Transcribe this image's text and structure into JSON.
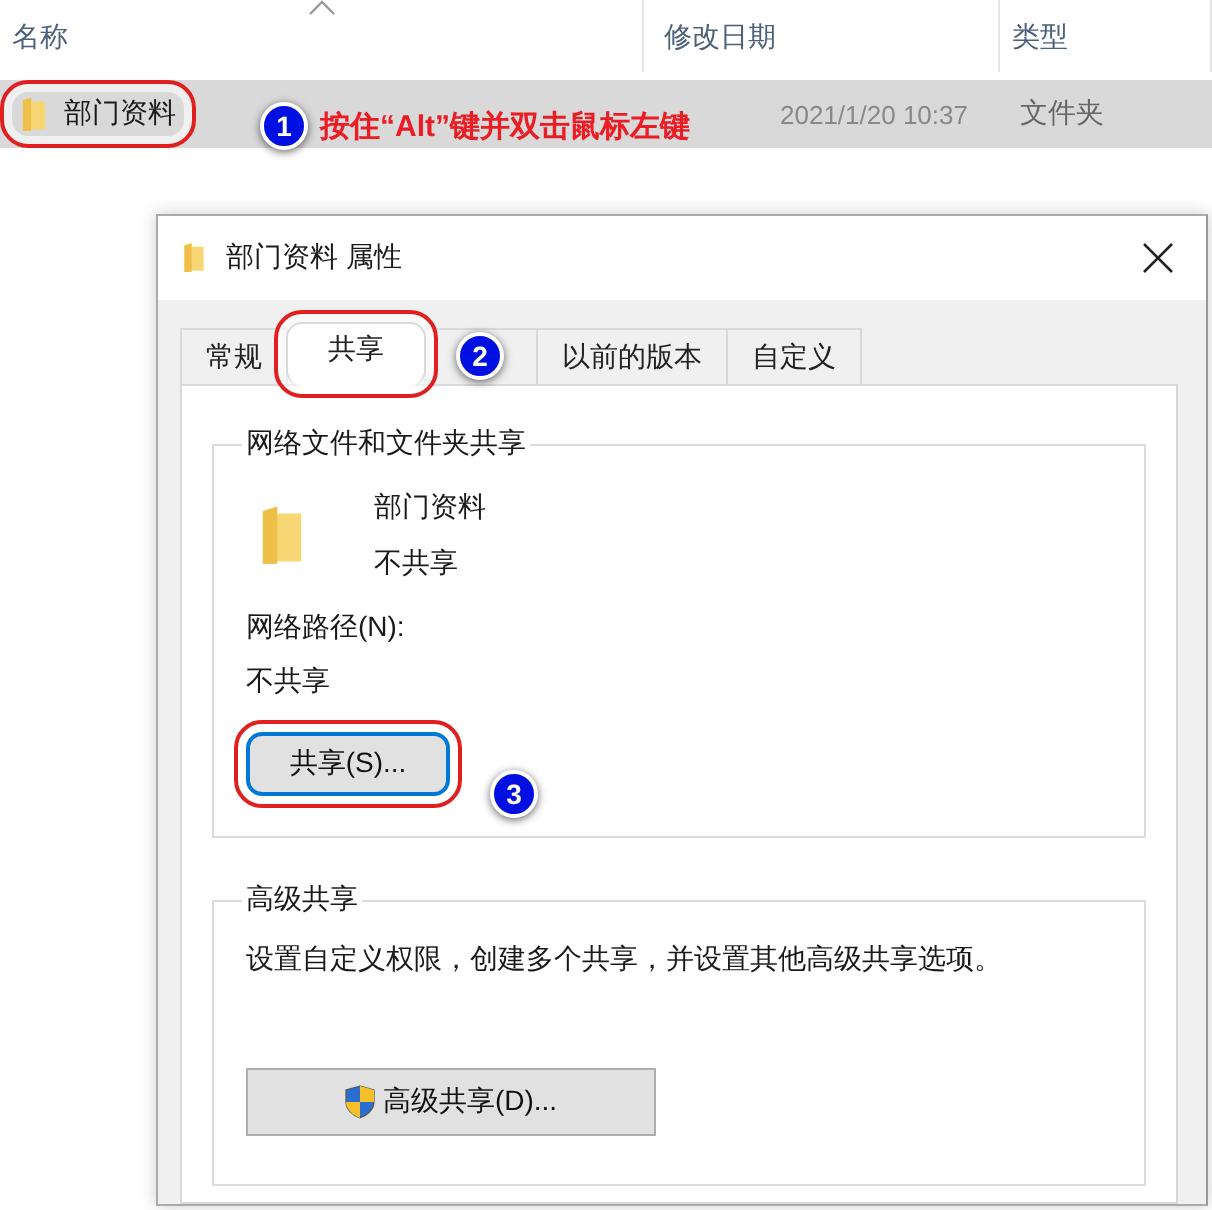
{
  "explorer": {
    "columns": [
      "名称",
      "修改日期",
      "类型"
    ],
    "rows": [
      {
        "name": "部门资料",
        "modified": "2021/1/20 10:37",
        "type": "文件夹",
        "selected": true,
        "highlighted": true
      }
    ]
  },
  "annotations": [
    {
      "number": "1",
      "text": "按住“Alt”键并双击鼠标左键"
    },
    {
      "number": "2"
    },
    {
      "number": "3"
    }
  ],
  "dialog": {
    "title": "部门资料 属性",
    "tabs": [
      {
        "label": "常规",
        "selected": false
      },
      {
        "label": "共享",
        "selected": true,
        "highlighted": true
      },
      {
        "selected": false
      },
      {
        "label": "以前的版本",
        "selected": false
      },
      {
        "label": "自定义",
        "selected": false
      }
    ],
    "network_sharing": {
      "heading": "网络文件和文件夹共享",
      "folder_name": "部门资料",
      "status": "不共享",
      "path_label": "网络路径(N):",
      "path_value": "不共享",
      "button": {
        "label": "共享(S)...",
        "focused": true,
        "highlighted": true
      }
    },
    "advanced_sharing": {
      "heading": "高级共享",
      "description": "设置自定义权限，创建多个共享，并设置其他高级共享选项。",
      "button": {
        "label": "高级共享(D)..."
      }
    }
  }
}
